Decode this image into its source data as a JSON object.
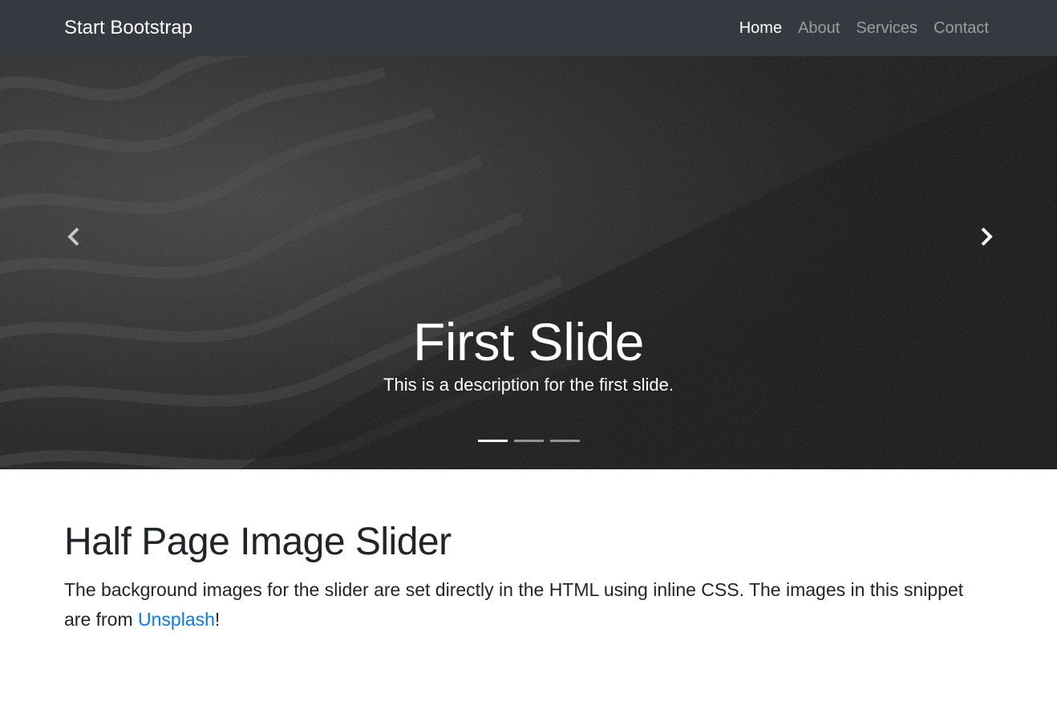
{
  "navbar": {
    "brand": "Start Bootstrap",
    "links": [
      {
        "label": "Home",
        "active": true
      },
      {
        "label": "About",
        "active": false
      },
      {
        "label": "Services",
        "active": false
      },
      {
        "label": "Contact",
        "active": false
      }
    ]
  },
  "slider": {
    "caption_title": "First Slide",
    "caption_text": "This is a description for the first slide.",
    "prev_icon": "chevron-left-icon",
    "next_icon": "chevron-right-icon",
    "indicator_count": 3,
    "active_indicator": 1
  },
  "content": {
    "heading": "Half Page Image Slider",
    "text_before": "The background images for the slider are set directly in the HTML using inline CSS. The images in this snippet are from ",
    "link_text": "Unsplash",
    "text_after": "!"
  },
  "colors": {
    "navbar_bg": "#343a40",
    "link": "#007bff",
    "text": "#212529"
  }
}
